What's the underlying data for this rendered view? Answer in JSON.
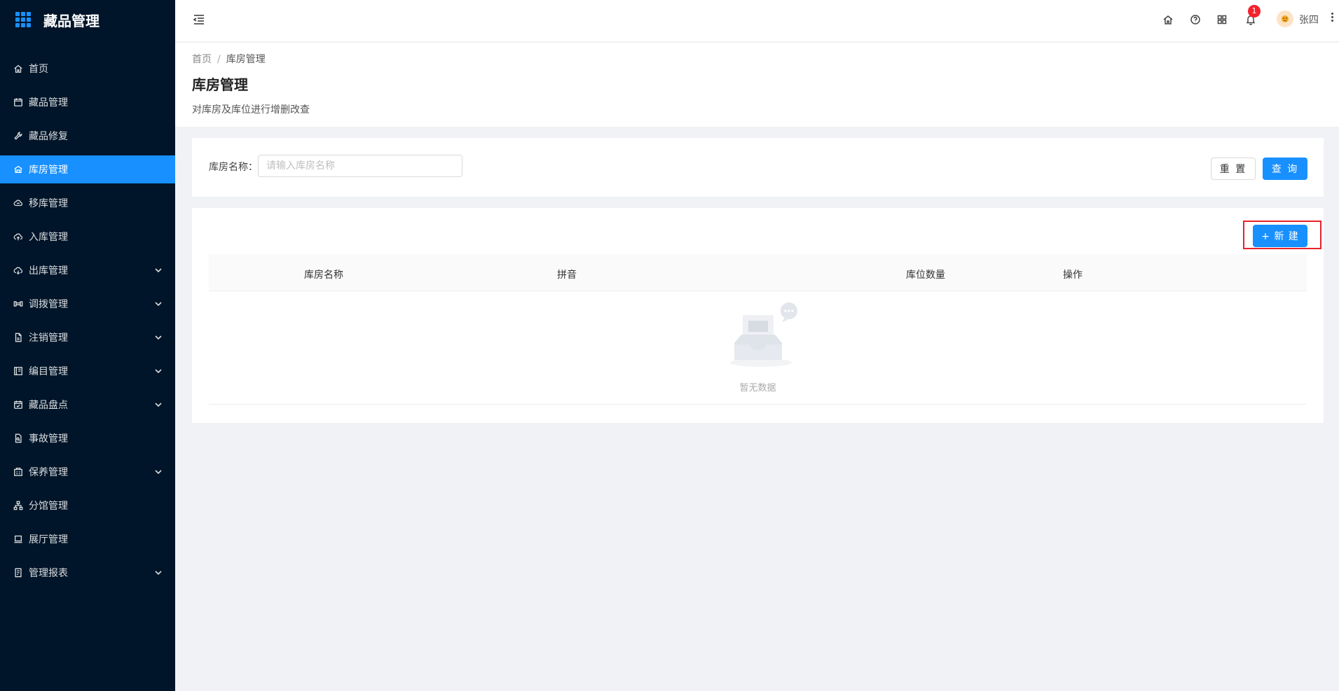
{
  "app": {
    "title": "藏品管理"
  },
  "sidebar": {
    "items": [
      {
        "label": "首页",
        "icon": "home-icon",
        "active": false,
        "expandable": false
      },
      {
        "label": "藏品管理",
        "icon": "calendar-icon",
        "active": false,
        "expandable": false
      },
      {
        "label": "藏品修复",
        "icon": "wrench-icon",
        "active": false,
        "expandable": false
      },
      {
        "label": "库房管理",
        "icon": "warehouse-icon",
        "active": true,
        "expandable": false
      },
      {
        "label": "移库管理",
        "icon": "cloud-sync-icon",
        "active": false,
        "expandable": false
      },
      {
        "label": "入库管理",
        "icon": "cloud-upload-icon",
        "active": false,
        "expandable": false
      },
      {
        "label": "出库管理",
        "icon": "cloud-download-icon",
        "active": false,
        "expandable": true
      },
      {
        "label": "调拨管理",
        "icon": "transfer-icon",
        "active": false,
        "expandable": true
      },
      {
        "label": "注销管理",
        "icon": "file-icon",
        "active": false,
        "expandable": true
      },
      {
        "label": "编目管理",
        "icon": "catalog-icon",
        "active": false,
        "expandable": true
      },
      {
        "label": "藏品盘点",
        "icon": "calendar-check-icon",
        "active": false,
        "expandable": true
      },
      {
        "label": "事故管理",
        "icon": "file-search-icon",
        "active": false,
        "expandable": false
      },
      {
        "label": "保养管理",
        "icon": "maintenance-icon",
        "active": false,
        "expandable": true
      },
      {
        "label": "分馆管理",
        "icon": "org-chart-icon",
        "active": false,
        "expandable": false
      },
      {
        "label": "展厅管理",
        "icon": "laptop-icon",
        "active": false,
        "expandable": false
      },
      {
        "label": "管理报表",
        "icon": "report-icon",
        "active": false,
        "expandable": true
      }
    ]
  },
  "header": {
    "notification_count": "1",
    "username": "张四"
  },
  "page": {
    "breadcrumb": {
      "home": "首页",
      "separator": "/",
      "current": "库房管理"
    },
    "title": "库房管理",
    "description": "对库房及库位进行增删改查"
  },
  "search": {
    "label": "库房名称：",
    "placeholder": "请输入库房名称",
    "value": "",
    "reset_label": "重 置",
    "query_label": "查 询"
  },
  "table": {
    "new_label": "+ 新 建",
    "columns": [
      "库房名称",
      "拼音",
      "库位数量",
      "操作"
    ],
    "rows": [],
    "empty_text": "暂无数据"
  },
  "colors": {
    "sidebar_bg": "#001529",
    "primary": "#1890ff",
    "highlight_border": "#e8212b",
    "badge": "#f5222d"
  }
}
